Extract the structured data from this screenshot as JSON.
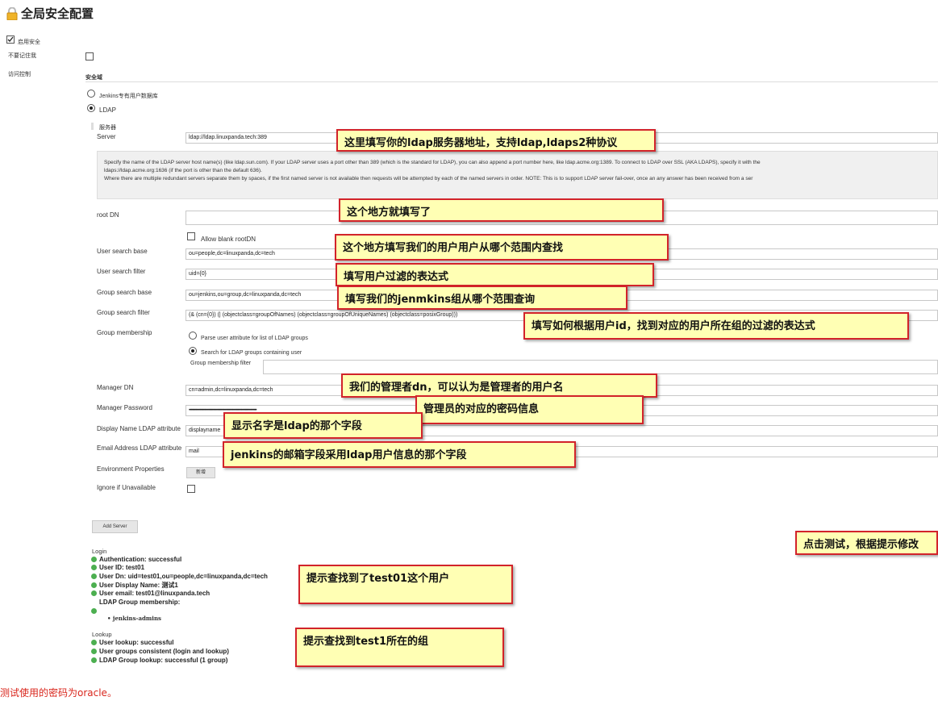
{
  "page": {
    "title": "全局安全配置",
    "enable_security": "启用安全",
    "remember_me": "不要记住我",
    "access_control": "访问控制",
    "security_realm": "安全域",
    "realm_jenkins_db": "Jenkins专有用户数据库",
    "realm_ldap": "LDAP",
    "server_section": "服务器"
  },
  "form": {
    "server_label": "Server",
    "server_value": "ldap://ldap.linuxpanda.tech:389",
    "help_line1": "Specify the name of the LDAP server host name(s) (like ldap.sun.com). If your LDAP server uses a port other than 389 (which is the standard for LDAP), you can also append a port number here, like ldap.acme.org:1389. To connect to LDAP over SSL (AKA LDAPS), specify it with the",
    "help_line2": "ldaps://ldap.acme.org:1636 (if the port is other than the default 636).",
    "help_line3": "Where there are multiple redundant servers separate them by spaces, if the first named server is not available then requests will be attempted by each of the named servers in order. NOTE: This is to support LDAP server fail-over, once an any answer has been received from a ser",
    "root_dn_label": "root DN",
    "root_dn_value": "",
    "allow_blank_root_dn": "Allow blank rootDN",
    "user_search_base_label": "User search base",
    "user_search_base_value": "ou=people,dc=linuxpanda,dc=tech",
    "user_search_filter_label": "User search filter",
    "user_search_filter_value": "uid={0}",
    "group_search_base_label": "Group search base",
    "group_search_base_value": "ou=jenkins,ou=group,dc=linuxpanda,dc=tech",
    "group_search_filter_label": "Group search filter",
    "group_search_filter_value": "(& (cn={0}) (| (objectclass=groupOfNames) (objectclass=groupOfUniqueNames) (objectclass=posixGroup)))",
    "group_membership_label": "Group membership",
    "parse_user_attribute": "Parse user attribute for list of LDAP groups",
    "search_ldap_groups": "Search for LDAP groups containing user",
    "group_membership_filter_label": "Group membership filter",
    "manager_dn_label": "Manager DN",
    "manager_dn_value": "cn=admin,dc=linuxpanda,dc=tech",
    "manager_password_label": "Manager Password",
    "manager_password_value": "••••••••••••••••••••••••••••••••••••••••••••••••••••••••••••••••••••••••••••",
    "display_name_label": "Display Name LDAP attribute",
    "display_name_value": "displayname",
    "email_label": "Email Address LDAP attribute",
    "email_value": "mail",
    "env_props_label": "Environment Properties",
    "env_add_button": "新增",
    "ignore_unavailable_label": "Ignore if Unavailable",
    "add_server_button": "Add Server"
  },
  "results": {
    "login_heading": "Login",
    "auth": "Authentication: successful",
    "user_id": "User ID: test01",
    "user_dn": "User Dn: uid=test01,ou=people,dc=linuxpanda,dc=tech",
    "display_name": "User Display Name: 测试1",
    "email": "User email: test01@linuxpanda.tech",
    "group_membership": "LDAP Group membership:",
    "group_item": "jenkins-admins",
    "lookup_heading": "Lookup",
    "user_lookup": "User lookup: successful",
    "groups_consistent": "User groups consistent (login and lookup)",
    "group_lookup": "LDAP Group lookup: successful (1 group)"
  },
  "notes": {
    "server": "这里填写你的ldap服务器地址，支持ldap,ldaps2种协议",
    "root_dn": "这个地方就填写了",
    "user_search_base": "这个地方填写我们的用户用户从哪个范围内查找",
    "user_filter": "填写用户过滤的表达式",
    "group_base": "填写我们的jenmkins组从哪个范围查询",
    "group_filter": "填写如何根据用户id，找到对应的用户所在组的过滤的表达式",
    "manager_dn": "我们的管理者dn，可以认为是管理者的用户名",
    "manager_pw": "管理员的对应的密码信息",
    "display_name": "显示名字是ldap的那个字段",
    "email": "jenkins的邮箱字段采用ldap用户信息的那个字段",
    "test": "点击测试，根据提示修改",
    "found_user": "提示查找到了test01这个用户",
    "found_group": "提示查找到test1所在的组"
  },
  "footer": {
    "password_note": "测试使用的密码为oracle。"
  },
  "colors": {
    "note_bg": "#ffffb4",
    "note_border": "#d2232a",
    "success": "#4caf50",
    "footer_text": "#d9261c"
  }
}
